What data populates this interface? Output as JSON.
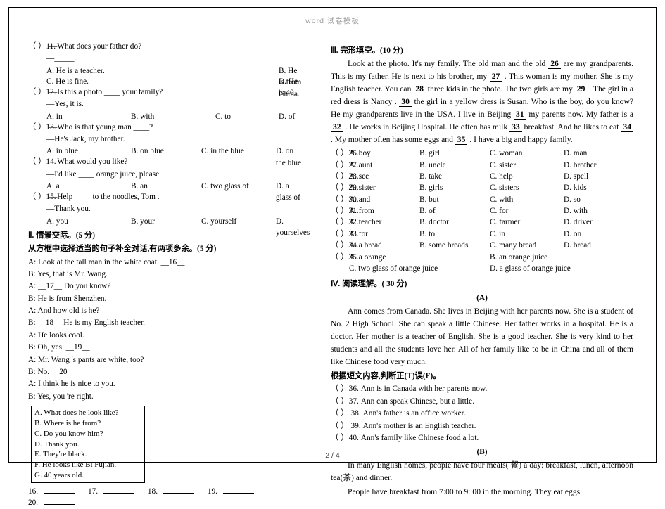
{
  "watermark": "word 试卷模板",
  "page_footer": "2 / 4",
  "left": {
    "questions": [
      {
        "paren": "（    ）11.",
        "stem": "—What does your father do?",
        "sub": "—_____.",
        "options": [
          "A. He is a teacher.",
          "B. He is from China.",
          "C. He is fine.",
          "D. He is 40."
        ],
        "layout": "two"
      },
      {
        "paren": "（    ）12.",
        "stem": "—Is this a photo ____ your family?",
        "sub": "—Yes, it is.",
        "options": [
          "A. in",
          "B. with",
          "C. to",
          "D. of"
        ],
        "layout": "four"
      },
      {
        "paren": "（    ）13.",
        "stem": "—Who is that young man ____?",
        "sub": "—He's Jack, my brother.",
        "options": [
          "A. in blue",
          "B. on blue",
          "C. in the blue",
          "D. on the blue"
        ],
        "layout": "four"
      },
      {
        "paren": "（    ）14.",
        "stem": "—What would you like?",
        "sub": "—I'd like ____ orange juice, please.",
        "options": [
          "A. a",
          "B. an",
          "C. two glass of",
          "D. a glass of"
        ],
        "layout": "four"
      },
      {
        "paren": "（    ）15.",
        "stem": "—Help ____ to the noodles, Tom .",
        "sub": "—Thank you.",
        "options": [
          "A. you",
          "B. your",
          "C. yourself",
          "D. yourselves"
        ],
        "layout": "four"
      }
    ],
    "section2_title": "Ⅱ. 情景交际。(5 分)",
    "box_instruction": "从方框中选择适当的句子补全对话,有两项多余。(5 分)",
    "dialog": [
      "A: Look at the tall man in the white coat.  __16__",
      "B: Yes, that is Mr. Wang.",
      "A:   __17__  Do you know?",
      "B: He is from Shenzhen.",
      "A: And how old is he?",
      "B:   __18__  He is my English teacher.",
      "A: He looks cool.",
      "B: Oh, yes.   __19__",
      "A: Mr. Wang 's pants are white, too?",
      "B: No.   __20__",
      "A: I think he is nice to you.",
      "B: Yes, you 're right."
    ],
    "choices": [
      "A. What does he look like?",
      "B. Where is he from?",
      "C. Do you know him?",
      "D. Thank you.",
      "E. They're black.",
      "F. He looks like Bi Fujian.",
      "G. 40 years old."
    ],
    "answer_labels": [
      "16.",
      "17.",
      "18.",
      "19.",
      "20."
    ]
  },
  "right": {
    "section3_title": "Ⅲ. 完形填空。(10 分)",
    "cloze_paragraphs": [
      "Look at the photo. It's my family. The old man and the old ",
      " are my grandparents. This is my father. He is next to his brother, my ",
      " . This woman is my mother. She is my English teacher. You can ",
      " three kids in the photo. The two girls are my ",
      " . The girl in a red dress is Nancy . ",
      " the girl in a yellow dress is Susan. Who is the boy, do you know? He ",
      " my grandparents live in the USA. I live in Beijing ",
      " my parents now. My father is a ",
      " . He works in Beijing Hospital. He often has milk ",
      " breakfast. And he likes to eat ",
      " . My mother often has some eggs and ",
      " . I have a big and happy family."
    ],
    "cloze_numbers": [
      "26",
      "27",
      "28",
      "29",
      "30",
      "31",
      "32",
      "33",
      "34",
      "35"
    ],
    "cloze_questions": [
      {
        "paren": "（    ）26.",
        "options": [
          "A. boy",
          "B. girl",
          "C. woman",
          "D. man"
        ]
      },
      {
        "paren": "（    ）27.",
        "options": [
          "A. aunt",
          "B. uncle",
          "C. sister",
          "D. brother"
        ]
      },
      {
        "paren": "（    ）28.",
        "options": [
          "A. see",
          "B. take",
          "C. help",
          "D. spell"
        ]
      },
      {
        "paren": "（    ）29.",
        "options": [
          "A. sister",
          "B. girls",
          "C. sisters",
          "D. kids"
        ]
      },
      {
        "paren": "（    ）30.",
        "options": [
          "A. and",
          "B. but",
          "C. with",
          "D. so"
        ]
      },
      {
        "paren": "（    ）31.",
        "options": [
          "A. from",
          "B. of",
          "C. for",
          "D. with"
        ]
      },
      {
        "paren": "（    ）32.",
        "options": [
          "A. teacher",
          "B. doctor",
          "C. farmer",
          "D. driver"
        ]
      },
      {
        "paren": "（    ）33.",
        "options": [
          "A. for",
          "B. to",
          "C. in",
          "D. on"
        ]
      },
      {
        "paren": "（    ）34.",
        "options": [
          "A. a bread",
          "B. some breads",
          "C. many bread",
          "D. bread"
        ]
      },
      {
        "paren": "（    ）35.",
        "options": [
          "A. a orange",
          "B. an orange juice"
        ]
      }
    ],
    "cloze_q35_line2": [
      "C. two glass of orange juice",
      "D. a glass of orange juice"
    ],
    "section4_title": "Ⅳ. 阅读理解。( 30 分)",
    "passage_a_label": "(A)",
    "passage_a": "Ann comes from Canada. She lives in Beijing with her parents now. She is a student of No. 2 High School. She can speak a little Chinese. Her father works in a hospital. He is a doctor. Her mother is a teacher of English. She is a good teacher. She is very kind to her students and all the students love her. All of her family like to be in China and all of them like Chinese food very much.",
    "tf_instruction": "根据短文内容,判断正(T)误(F)。",
    "tf_items": [
      "（    ）36. Ann is in Canada with her parents now.",
      "（    ）37. Ann can speak Chinese, but a little.",
      "（    ） 38. Ann's father is an office worker.",
      "（    ） 39. Ann's mother is an English teacher.",
      "（    ）40. Ann's family like Chinese food a lot."
    ],
    "passage_b_label": "(B)",
    "passage_b_p1": "In many English homes, people have four meals( 餐) a day: breakfast, lunch, afternoon tea(茶) and dinner.",
    "passage_b_p2": "People have breakfast from 7:00 to 9: 00 in the morning. They eat eggs"
  }
}
